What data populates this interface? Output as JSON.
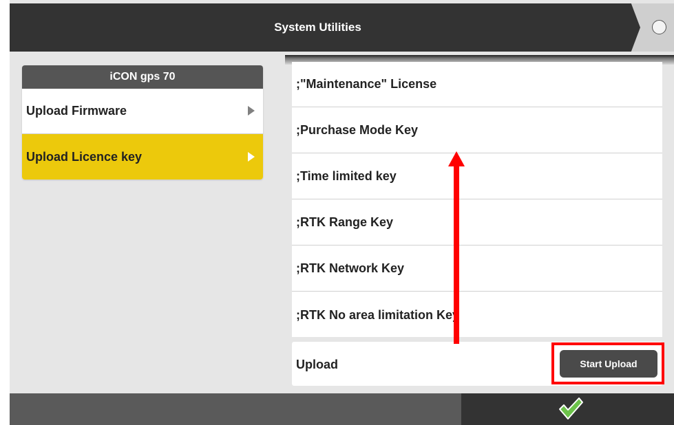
{
  "header": {
    "title": "System Utilities"
  },
  "device_panel": {
    "title": "iCON gps 70",
    "items": [
      {
        "label": "Upload Firmware",
        "active": false
      },
      {
        "label": "Upload Licence key",
        "active": true
      }
    ]
  },
  "key_list": {
    "items": [
      {
        "label": ";\"Maintenance\" License"
      },
      {
        "label": ";Purchase Mode Key"
      },
      {
        "label": ";Time limited key"
      },
      {
        "label": ";RTK Range Key"
      },
      {
        "label": ";RTK Network Key"
      },
      {
        "label": ";RTK No area limitation Key"
      }
    ]
  },
  "upload": {
    "label": "Upload",
    "button_label": "Start Upload"
  },
  "icons": {
    "header_status": "radio-circle-icon",
    "footer_confirm": "checkmark-icon",
    "menu_chevron": "triangle-right-icon"
  },
  "colors": {
    "header_bg": "#333333",
    "accent_yellow": "#ecc90c",
    "annotation_red": "#ff0000",
    "confirm_green": "#5cb85c"
  }
}
